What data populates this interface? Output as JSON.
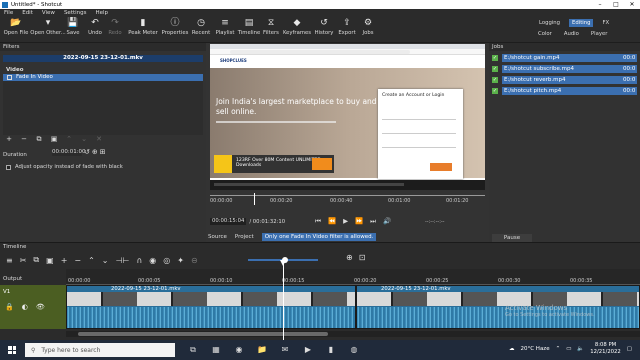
{
  "window": {
    "title": "Untitled* - Shotcut"
  },
  "menu": [
    "File",
    "Edit",
    "View",
    "Settings",
    "Help"
  ],
  "toolbar": {
    "items": [
      {
        "label": "Open File",
        "icon": "folder-open-icon",
        "glyph": "📂"
      },
      {
        "label": "Open Other...",
        "icon": "open-other-icon",
        "glyph": "▾"
      },
      {
        "label": "Save",
        "icon": "save-icon",
        "glyph": "💾"
      },
      {
        "label": "Undo",
        "icon": "undo-icon",
        "glyph": "↶"
      },
      {
        "label": "Redo",
        "icon": "redo-icon",
        "glyph": "↷"
      },
      {
        "label": "Peak Meter",
        "icon": "peak-meter-icon",
        "glyph": "▮"
      },
      {
        "label": "Properties",
        "icon": "properties-icon",
        "glyph": "ⓘ"
      },
      {
        "label": "Recent",
        "icon": "recent-icon",
        "glyph": "◷"
      },
      {
        "label": "Playlist",
        "icon": "playlist-icon",
        "glyph": "≡"
      },
      {
        "label": "Timeline",
        "icon": "timeline-icon",
        "glyph": "▤"
      },
      {
        "label": "Filters",
        "icon": "filters-icon",
        "glyph": "⧖"
      },
      {
        "label": "Keyframes",
        "icon": "keyframes-icon",
        "glyph": "◆"
      },
      {
        "label": "History",
        "icon": "history-icon",
        "glyph": "↺"
      },
      {
        "label": "Export",
        "icon": "export-icon",
        "glyph": "⇪"
      },
      {
        "label": "Jobs",
        "icon": "jobs-icon",
        "glyph": "⚙"
      }
    ],
    "layouts_top": [
      "Logging",
      "Editing",
      "FX"
    ],
    "layouts_bottom": [
      "Color",
      "Audio",
      "Player"
    ],
    "active_layout": "Editing"
  },
  "filters": {
    "title": "Filters",
    "clip_name": "2022-09-15 23-12-01.mkv",
    "section": "Video",
    "items": [
      "Fade In Video"
    ],
    "duration_label": "Duration",
    "duration_value": "00:00:01:00",
    "adjust_label": "Adjust opacity instead of fade with black"
  },
  "player": {
    "hero_text": "Join India's largest marketplace to buy and sell online.",
    "login_title": "Create an Account or Login",
    "ad_text": "Over 80M Content UNLIMITED Downloads",
    "ad_brand": "123RF",
    "site_logo": "SHOPCLUES",
    "ruler_labels": [
      "00:00:00",
      "00:00:20",
      "00:00:40",
      "00:01:00",
      "00:01:20"
    ],
    "position": "00:00:15:04",
    "duration": "/ 00:01:32:10",
    "in_out": "--:--:--:--",
    "tabs": [
      "Source",
      "Project"
    ],
    "status": "Only one Fade In Video filter is allowed."
  },
  "jobs": {
    "title": "Jobs",
    "items": [
      {
        "name": "E:/shotcut gain.mp4",
        "time": "00:0"
      },
      {
        "name": "E:/shotcut subscribe.mp4",
        "time": "00:0"
      },
      {
        "name": "E:/shotcut reverb.mp4",
        "time": "00:0"
      },
      {
        "name": "E:/shotcut pitch.mp4",
        "time": "00:0"
      }
    ],
    "pause_label": "Pause"
  },
  "timeline": {
    "title": "Timeline",
    "output_label": "Output",
    "track_label": "V1",
    "ruler": [
      "00:00:00",
      "00:00:05",
      "00:00:10",
      "00:00:15",
      "00:00:20",
      "00:00:25",
      "00:00:30",
      "00:00:35"
    ],
    "clip_name": "2022-09-15 23-12-01.mkv"
  },
  "watermark": {
    "title": "Activate Windows",
    "sub": "Go to Settings to activate Windows."
  },
  "taskbar": {
    "search_placeholder": "Type here to search",
    "weather": "20°C Haze",
    "time": "8:08 PM",
    "date": "12/21/2022"
  },
  "colors": {
    "accent": "#3b6fb0",
    "panel": "#323232",
    "clip": "#2a6e9a",
    "track_header": "#4b5e22"
  }
}
